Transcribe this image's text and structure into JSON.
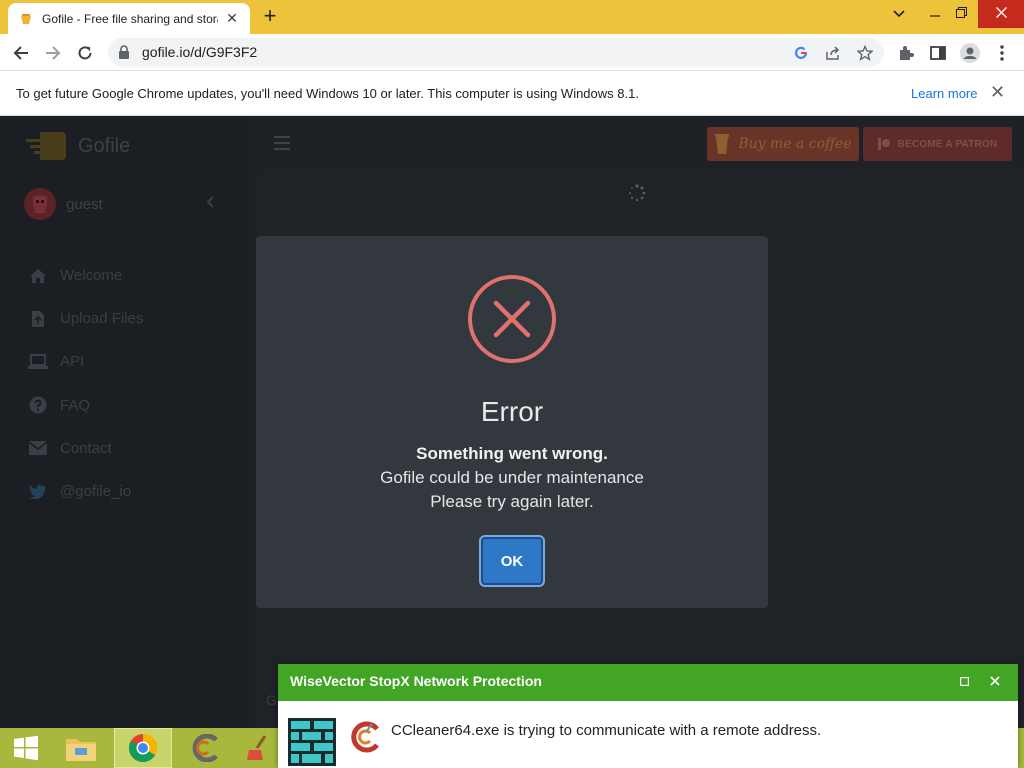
{
  "browser": {
    "tab_title": "Gofile - Free file sharing and storage",
    "tab_close": "✕",
    "new_tab": "+",
    "url": "gofile.io/d/G9F3F2"
  },
  "infobar": {
    "message": "To get future Google Chrome updates, you'll need Windows 10 or later. This computer is using Windows 8.1.",
    "learn_more": "Learn more",
    "close": "✕"
  },
  "site": {
    "brand": "Gofile",
    "user": "guest",
    "menu": [
      {
        "label": "Welcome",
        "icon": "home-icon"
      },
      {
        "label": "Upload Files",
        "icon": "file-upload-icon"
      },
      {
        "label": "API",
        "icon": "laptop-icon"
      },
      {
        "label": "FAQ",
        "icon": "question-icon"
      },
      {
        "label": "Contact",
        "icon": "envelope-icon"
      },
      {
        "label": "@gofile_io",
        "icon": "twitter-icon"
      }
    ],
    "buy_coffee": "Buy me a coffee",
    "become_patron": "BECOME A PATRON",
    "footer_fragment": "G"
  },
  "modal": {
    "title": "Error",
    "strong": "Something went wrong.",
    "line2": "Gofile could be under maintenance",
    "line3": "Please try again later.",
    "ok": "OK"
  },
  "popup": {
    "title": "WiseVector StopX Network Protection",
    "message": "CCleaner64.exe is trying to communicate with a remote address."
  },
  "colors": {
    "chrome_frame": "#ecc33a",
    "modal_bg": "#33373e",
    "error_red": "#e0726e",
    "ok_blue": "#2f78c8",
    "popup_green": "#43a526",
    "taskbar": "#a7b83c"
  }
}
